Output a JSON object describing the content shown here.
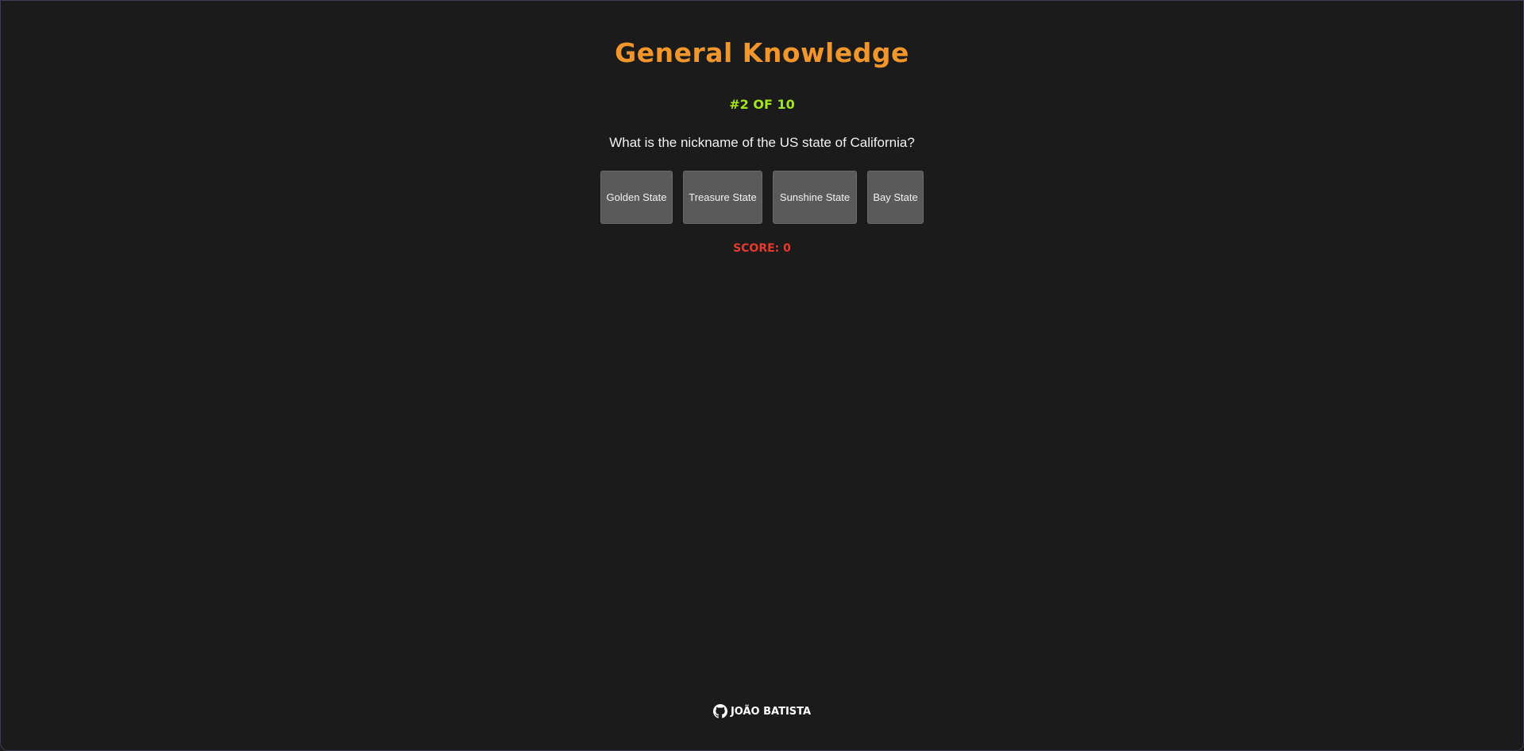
{
  "quiz": {
    "title": "General Knowledge",
    "counter": "#2 of 10",
    "question": "What is the nickname of the US state of California?",
    "answers": [
      {
        "label": "Golden State"
      },
      {
        "label": "Treasure State"
      },
      {
        "label": "Sunshine State"
      },
      {
        "label": "Bay State"
      }
    ],
    "score": "Score: 0"
  },
  "footer": {
    "author": "João Batista",
    "icon": "github-icon"
  },
  "colors": {
    "background": "#1b1b1b",
    "title": "#f0962c",
    "counter": "#a4e51c",
    "score": "#e63b2e",
    "button": "#5a5a5a"
  }
}
